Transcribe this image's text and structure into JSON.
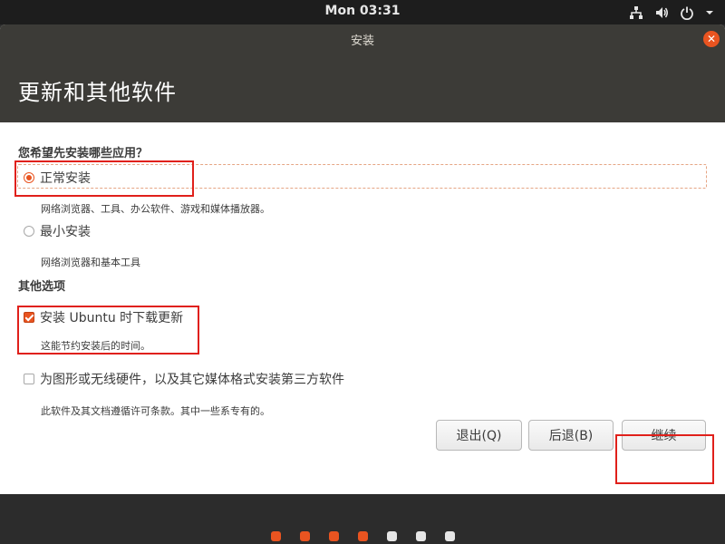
{
  "panel": {
    "clock": "Mon 03:31"
  },
  "window": {
    "title": "安装",
    "heading": "更新和其他软件"
  },
  "content": {
    "question": "您希望先安装哪些应用？",
    "options": [
      {
        "label": "正常安装",
        "desc": "网络浏览器、工具、办公软件、游戏和媒体播放器。",
        "selected": true
      },
      {
        "label": "最小安装",
        "desc": "网络浏览器和基本工具",
        "selected": false
      }
    ],
    "other_label": "其他选项",
    "checks": [
      {
        "label": "安装 Ubuntu 时下载更新",
        "desc": "这能节约安装后的时间。",
        "checked": true
      },
      {
        "label": "为图形或无线硬件，以及其它媒体格式安装第三方软件",
        "desc": "此软件及其文档遵循许可条款。其中一些系专有的。",
        "checked": false
      }
    ]
  },
  "buttons": {
    "quit": "退出(Q)",
    "back": "后退(B)",
    "continue": "继续"
  },
  "progress": {
    "total_steps": 7,
    "completed_steps": 4,
    "color_done": "#e95420",
    "color_todo": "#e6e6e6"
  },
  "colors": {
    "accent": "#e95420",
    "header_bg": "#3c3b37",
    "annotation": "#e0201b"
  }
}
